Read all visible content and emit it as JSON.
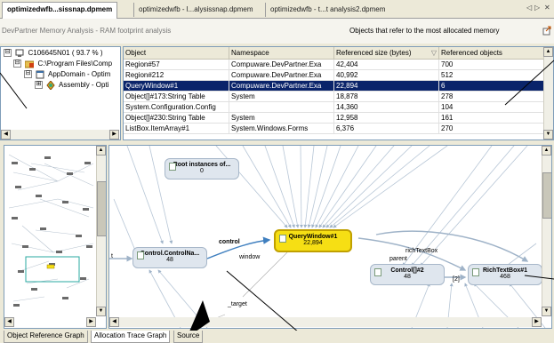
{
  "tabs": [
    {
      "label": "optimizedwfb...sissnap.dpmem",
      "active": true
    },
    {
      "label": "optimizedwfb - l...alysissnap.dpmem",
      "active": false
    },
    {
      "label": "optimizedwfb - t...t analysis2.dpmem",
      "active": false
    }
  ],
  "tab_nav": {
    "left": "◁",
    "right": "▷",
    "close": "✕"
  },
  "header": {
    "left_text": "DevPartner Memory Analysis - RAM footprint analysis",
    "right_text": "Objects that refer to the most allocated memory",
    "corner_icon": "export-icon"
  },
  "tree": [
    {
      "label": "C106645N01 ( 93.7 % )",
      "toggle": "⊟",
      "icon": "computer-icon"
    },
    {
      "label": "C:\\Program Files\\Comp",
      "toggle": "⊟",
      "icon": "folder-icon"
    },
    {
      "label": "AppDomain - Optim",
      "toggle": "⊟",
      "icon": "appdomain-icon"
    },
    {
      "label": "Assembly - Opti",
      "toggle": "⊞",
      "icon": "assembly-icon"
    }
  ],
  "table": {
    "columns": [
      "Object",
      "Namespace",
      "Referenced size (bytes)",
      "Referenced objects"
    ],
    "sort_glyph": "▽",
    "rows": [
      [
        "Region#57",
        "Compuware.DevPartner.Exa",
        "42,404",
        "700"
      ],
      [
        "Region#212",
        "Compuware.DevPartner.Exa",
        "40,992",
        "512"
      ],
      [
        "QueryWindow#1",
        "Compuware.DevPartner.Exa",
        "22,894",
        "6"
      ],
      [
        "Object[]#173:String Table",
        "System",
        "18,878",
        "278"
      ],
      [
        "System.Configuration.Config",
        "",
        "14,360",
        "104"
      ],
      [
        "Object[]#230:String Table",
        "System",
        "12,958",
        "161"
      ],
      [
        "ListBox.ItemArray#1",
        "System.Windows.Forms",
        "6,376",
        "270"
      ]
    ],
    "selected_row": 2
  },
  "graph": {
    "nodes": {
      "root": {
        "title": "Root instances of...",
        "value": "0"
      },
      "control": {
        "title": "Control.ControlNa...",
        "value": "48"
      },
      "query": {
        "title": "QueryWindow#1",
        "value": "22,894"
      },
      "control2": {
        "title": "Control[]#2",
        "value": "48"
      },
      "richtext": {
        "title": "RichTextBox#1",
        "value": "468"
      }
    },
    "edge_labels": {
      "control": "control",
      "window": "window",
      "richtextbox": "richTextBox",
      "parent": "parent",
      "index": "[2]",
      "target": "_target",
      "t": "t"
    }
  },
  "bottom_tabs": [
    {
      "label": "Object Reference Graph",
      "active": false
    },
    {
      "label": "Allocation Trace Graph",
      "active": true
    },
    {
      "label": "Source",
      "active": false
    }
  ],
  "colors": {
    "selection": "#0a246a",
    "highlight_node": "#f6df14",
    "node": "#dfe6ee",
    "edge": "#9fb3c8"
  }
}
